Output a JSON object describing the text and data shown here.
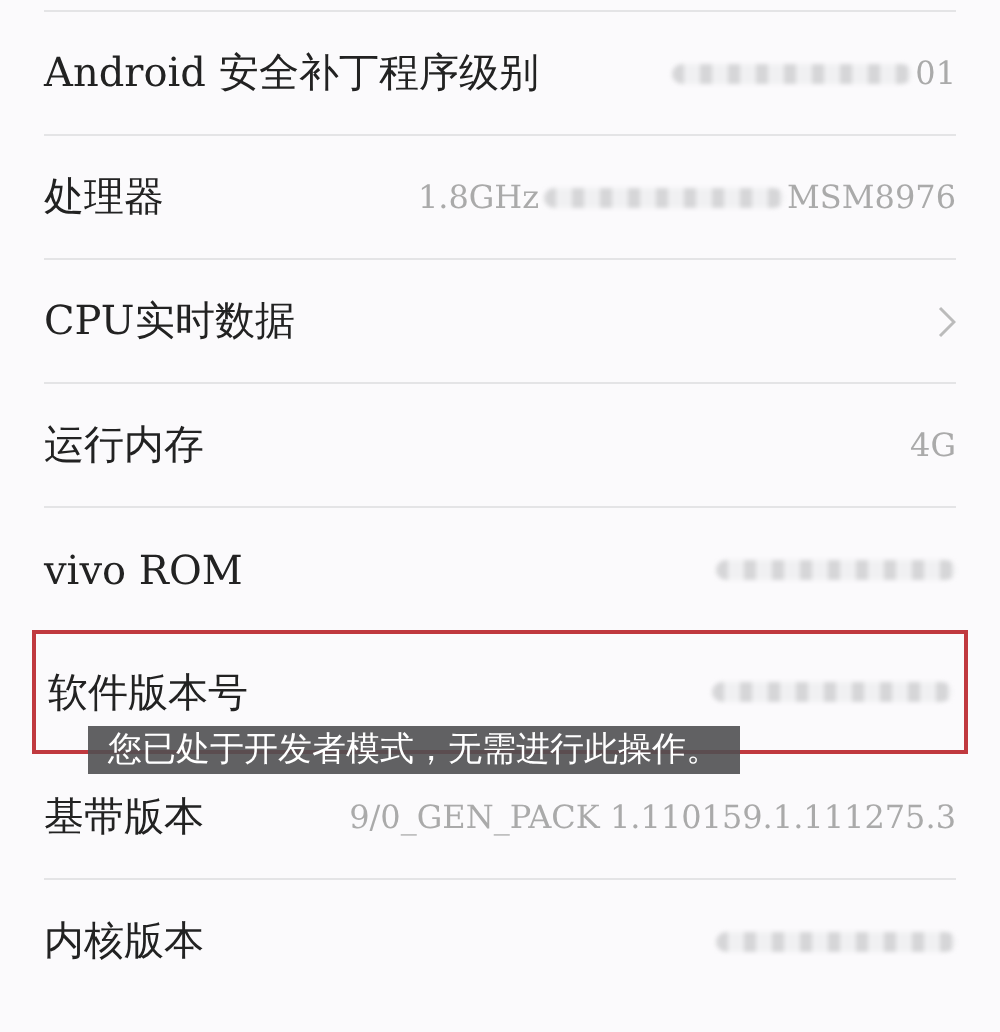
{
  "rows": [
    {
      "label": "Android 安全补丁程序级别",
      "highlighted": false,
      "value": [
        {
          "kind": "blur"
        },
        {
          "kind": "text",
          "text": "01"
        }
      ]
    },
    {
      "label": "处理器",
      "highlighted": false,
      "value": [
        {
          "kind": "text",
          "text": "1.8GHz"
        },
        {
          "kind": "blur"
        },
        {
          "kind": "text",
          "text": "MSM8976"
        }
      ]
    },
    {
      "label": "CPU实时数据",
      "highlighted": false,
      "value": [
        {
          "kind": "chevron"
        }
      ]
    },
    {
      "label": "运行内存",
      "highlighted": false,
      "value": [
        {
          "kind": "text",
          "text": "4G"
        }
      ]
    },
    {
      "label": "vivo ROM",
      "highlighted": false,
      "value": [
        {
          "kind": "blur"
        }
      ]
    },
    {
      "label": "软件版本号",
      "highlighted": true,
      "value": [
        {
          "kind": "blur"
        }
      ]
    },
    {
      "label": "基带版本",
      "highlighted": false,
      "value": [
        {
          "kind": "text",
          "text": "9/0_GEN_PACK 1.110159.1.111275.3"
        }
      ]
    },
    {
      "label": "内核版本",
      "highlighted": false,
      "value": [
        {
          "kind": "blur"
        }
      ]
    }
  ],
  "toast": {
    "text": "您已处于开发者模式，无需进行此操作。"
  }
}
